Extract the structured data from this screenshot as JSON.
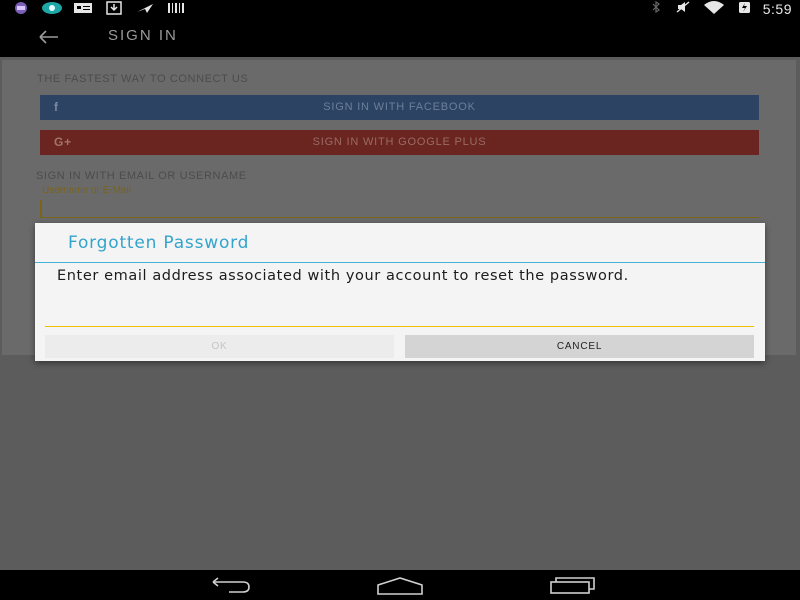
{
  "status_bar": {
    "time": "5:59",
    "left_icons": [
      "app-icon",
      "browser-icon",
      "notification-card-icon",
      "download-icon",
      "airplane-notice-icon",
      "barcode-icon"
    ],
    "right_icons": [
      "bluetooth-icon",
      "mute-icon",
      "wifi-icon",
      "battery-charging-icon"
    ]
  },
  "app_bar": {
    "title": "SIGN IN"
  },
  "sign_in": {
    "fastest_label": "THE FASTEST WAY TO CONNECT US",
    "facebook_label": "SIGN IN WITH FACEBOOK",
    "facebook_icon": "f",
    "google_label": "SIGN IN WITH GOOGLE PLUS",
    "google_icon": "G+",
    "email_section_label": "SIGN IN WITH EMAIL  OR USERNAME",
    "username_hint": "Username or E-Mail"
  },
  "dialog": {
    "title": "Forgotten Password",
    "message": "Enter email address associated with your account to reset the password.",
    "email_value": "",
    "ok_label": "OK",
    "cancel_label": "CANCEL"
  },
  "colors": {
    "dialog_accent": "#33a4cc",
    "input_underline": "#f0c000",
    "facebook_button": "#3b5998",
    "google_button": "#dd4b39"
  },
  "nav_bar": {
    "buttons": [
      "back-icon",
      "home-icon",
      "recents-icon"
    ]
  }
}
